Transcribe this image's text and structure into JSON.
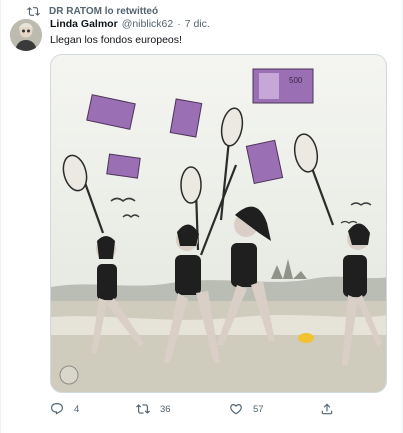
{
  "retweet": {
    "text": "DR RATOM lo retwitteó",
    "icon": "retweet-icon"
  },
  "tweet": {
    "author_name": "Linda Galmor",
    "author_handle": "@niblick62",
    "separator": "·",
    "date": "7 dic.",
    "text": "Llegan los fondos europeos!"
  },
  "media": {
    "image_label": "500"
  },
  "actions": {
    "reply": {
      "icon": "reply-icon",
      "count": "4"
    },
    "retweet": {
      "icon": "retweet-icon",
      "count": "36"
    },
    "like": {
      "icon": "heart-icon",
      "count": "57"
    },
    "share": {
      "icon": "share-icon",
      "count": ""
    }
  },
  "colors": {
    "text": "#0f1419",
    "muted": "#536471",
    "border": "#cfd9de",
    "banknote": "#9b6fb3"
  }
}
